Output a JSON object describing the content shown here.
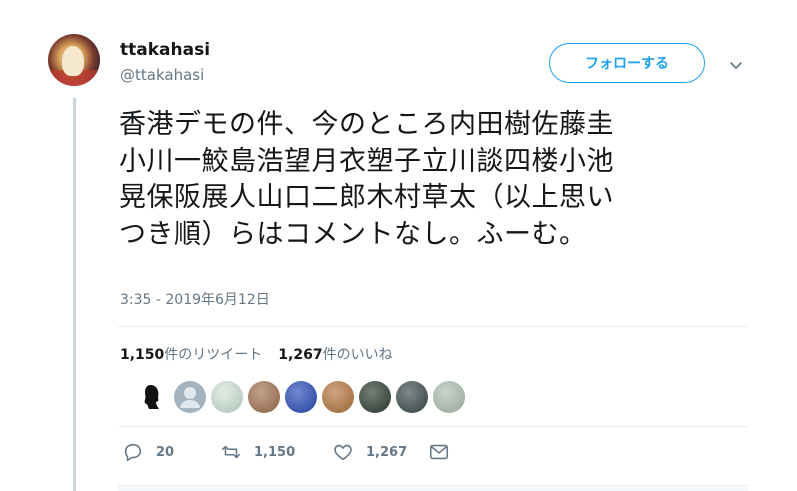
{
  "user": {
    "display_name": "ttakahasi",
    "handle": "@ttakahasi"
  },
  "follow_button_label": "フォローする",
  "tweet": {
    "lines": [
      "香港デモの件、今のところ内田樹佐藤圭",
      "小川一鮫島浩望月衣塑子立川談四楼小池",
      "晃保阪展人山口二郎木村草太（以上思い",
      "つき順）らはコメントなし。ふーむ。"
    ],
    "timestamp": "3:35 - 2019年6月12日"
  },
  "stats": {
    "retweets_count": "1,150",
    "retweets_label": "件のリツイート",
    "likes_count": "1,267",
    "likes_label": "件のいいね"
  },
  "likers": [
    {
      "icon": "silhouette-avatar",
      "color": "#ffffff"
    },
    {
      "icon": "default-avatar",
      "color": "#a4b3c0"
    },
    {
      "icon": "photo-avatar",
      "color": "#cfe3d8"
    },
    {
      "icon": "photo-avatar",
      "color": "#a2704f"
    },
    {
      "icon": "photo-avatar",
      "color": "#2649b8"
    },
    {
      "icon": "photo-avatar",
      "color": "#b5743d"
    },
    {
      "icon": "photo-avatar",
      "color": "#2c3b30"
    },
    {
      "icon": "photo-avatar",
      "color": "#3a4a4c"
    },
    {
      "icon": "photo-avatar",
      "color": "#aebfb2"
    }
  ],
  "actions": {
    "reply_count": "20",
    "retweet_count": "1,150",
    "like_count": "1,267"
  },
  "colors": {
    "accent": "#1da1f2",
    "muted": "#657786",
    "text": "#14171a"
  }
}
